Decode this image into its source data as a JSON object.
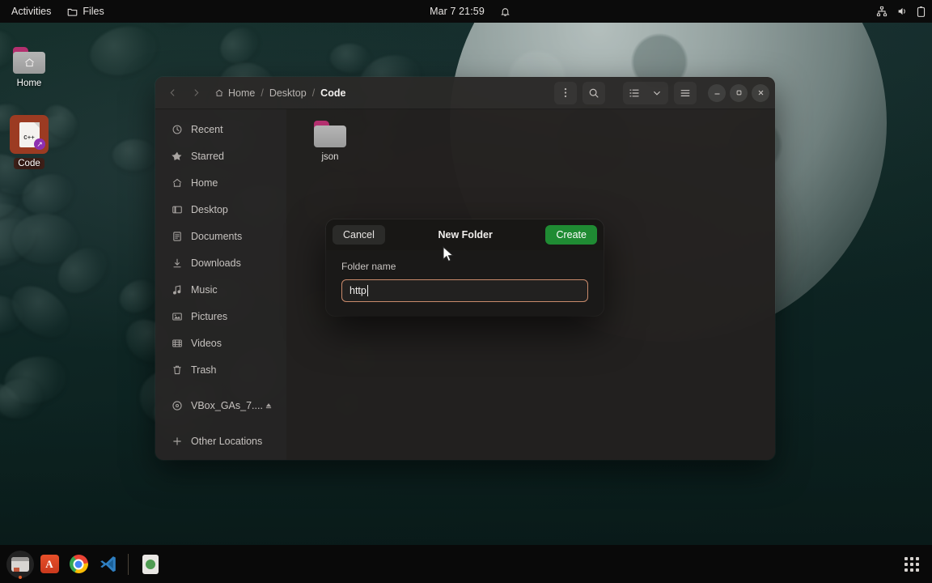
{
  "topbar": {
    "activities_label": "Activities",
    "app_menu_label": "Files",
    "app_menu_icon": "folder-icon",
    "clock": "Mar 7  21:59",
    "bell_icon": "notification-bell-icon",
    "network_icon": "network-icon",
    "volume_icon": "volume-icon",
    "battery_icon": "battery-icon"
  },
  "desktop": {
    "icons": [
      {
        "label": "Home",
        "type": "folder"
      },
      {
        "label": "Code",
        "type": "cpp-file-shortcut",
        "badge": "cpp"
      }
    ]
  },
  "file_manager": {
    "nav": {
      "back_icon": "chevron-left-icon",
      "forward_icon": "chevron-right-icon"
    },
    "breadcrumb": [
      {
        "label": "Home",
        "icon": "home-icon",
        "current": false
      },
      {
        "label": "Desktop",
        "icon": "",
        "current": false
      },
      {
        "label": "Code",
        "icon": "",
        "current": true
      }
    ],
    "breadcrumb_separator": "/",
    "header_buttons": {
      "menu_icon": "kebab-menu-icon",
      "search_icon": "search-icon",
      "view_list_icon": "list-view-icon",
      "view_dropdown_icon": "chevron-down-icon",
      "hamburger_icon": "hamburger-menu-icon"
    },
    "window_controls": {
      "minimize": "−",
      "maximize": "□",
      "close": "✕"
    },
    "sidebar": [
      {
        "label": "Recent",
        "icon": "clock-icon"
      },
      {
        "label": "Starred",
        "icon": "star-icon"
      },
      {
        "label": "Home",
        "icon": "home-icon"
      },
      {
        "label": "Desktop",
        "icon": "desktop-icon"
      },
      {
        "label": "Documents",
        "icon": "document-icon"
      },
      {
        "label": "Downloads",
        "icon": "download-icon"
      },
      {
        "label": "Music",
        "icon": "music-note-icon"
      },
      {
        "label": "Pictures",
        "icon": "picture-icon"
      },
      {
        "label": "Videos",
        "icon": "video-icon"
      },
      {
        "label": "Trash",
        "icon": "trash-icon"
      },
      {
        "label": "VBox_GAs_7....",
        "icon": "disc-icon",
        "eject": true
      },
      {
        "label": "Other Locations",
        "icon": "plus-icon"
      }
    ],
    "files": [
      {
        "label": "json",
        "type": "folder"
      }
    ]
  },
  "dialog": {
    "title": "New Folder",
    "cancel_label": "Cancel",
    "create_label": "Create",
    "field_label": "Folder name",
    "input_value": "http",
    "input_placeholder": "Folder name",
    "create_button_color": "#1f8b33",
    "input_focus_border_color": "#c98a6b"
  },
  "dock": {
    "items": [
      {
        "label": "Files",
        "icon": "files-icon",
        "active": true
      },
      {
        "label": "Ubuntu Software",
        "icon": "ubuntu-a-icon",
        "active": false
      },
      {
        "label": "Google Chrome",
        "icon": "chrome-icon",
        "active": false
      },
      {
        "label": "Visual Studio Code",
        "icon": "vscode-icon",
        "active": false
      }
    ],
    "after_separator": [
      {
        "label": "Software Updater",
        "icon": "software-center-icon",
        "active": false
      }
    ],
    "show_apps_label": "Show Applications",
    "show_apps_icon": "app-grid-icon"
  }
}
